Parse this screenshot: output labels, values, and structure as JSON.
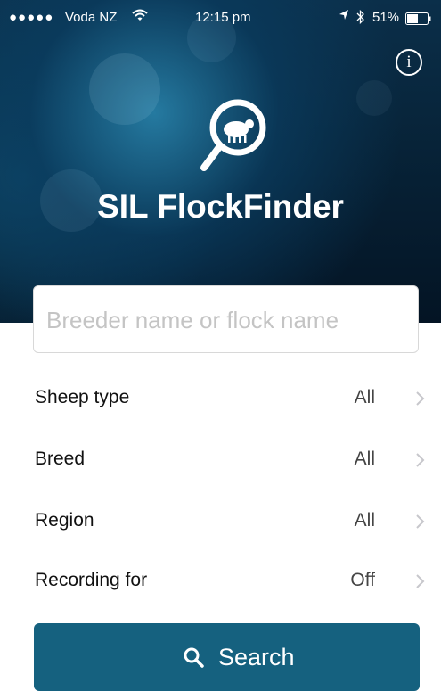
{
  "status_bar": {
    "signal": "●●●●●",
    "carrier": "Voda NZ",
    "time": "12:15 pm",
    "battery": "51%"
  },
  "header": {
    "title": "SIL FlockFinder",
    "info_label": "i"
  },
  "search": {
    "placeholder": "Breeder name or flock name",
    "value": ""
  },
  "filters": [
    {
      "label": "Sheep type",
      "value": "All"
    },
    {
      "label": "Breed",
      "value": "All"
    },
    {
      "label": "Region",
      "value": "All"
    },
    {
      "label": "Recording for",
      "value": "Off"
    }
  ],
  "search_button": {
    "label": "Search",
    "color": "#15617f"
  },
  "icons": [
    "wifi-icon",
    "location-arrow-icon",
    "bluetooth-icon",
    "battery-icon",
    "info-icon",
    "sheep-magnifier-logo-icon",
    "chevron-right-icon",
    "search-icon"
  ]
}
